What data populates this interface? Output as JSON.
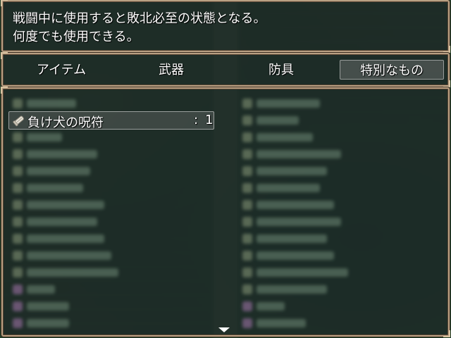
{
  "help": {
    "line1": "戦闘中に使用すると敗北必至の状態となる。",
    "line2": "何度でも使用できる。"
  },
  "tabs": [
    {
      "label": "アイテム"
    },
    {
      "label": "武器"
    },
    {
      "label": "防具"
    },
    {
      "label": "特別なもの"
    }
  ],
  "selected_tab": "特別なもの",
  "items": [
    {
      "icon": "scroll-icon",
      "name": "負け犬の呪符",
      "separator": ":",
      "count": "1"
    }
  ],
  "colors": {
    "frame": "#b9a083",
    "window": "#1e2826",
    "text": "#ffffff"
  }
}
